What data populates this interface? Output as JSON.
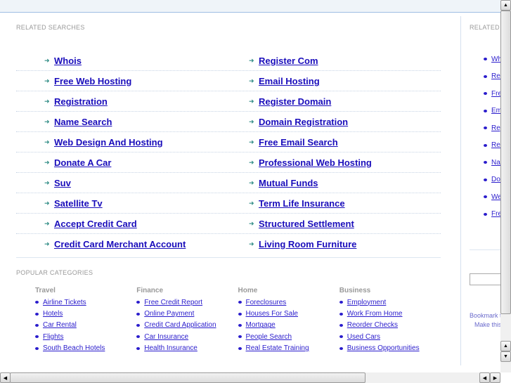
{
  "related": {
    "title": "RELATED SEARCHES",
    "left": [
      "Whois",
      "Free Web Hosting",
      "Registration",
      "Name Search",
      "Web Design And Hosting",
      "Donate A Car",
      "Suv",
      "Satellite Tv",
      "Accept Credit Card",
      "Credit Card Merchant Account"
    ],
    "right": [
      "Register Com",
      "Email Hosting",
      "Register Domain",
      "Domain Registration",
      "Free Email Search",
      "Professional Web Hosting",
      "Mutual Funds",
      "Term Life Insurance",
      "Structured Settlement",
      "Living Room Furniture"
    ]
  },
  "popular": {
    "title": "POPULAR CATEGORIES",
    "categories": [
      {
        "name": "Travel",
        "links": [
          "Airline Tickets",
          "Hotels",
          "Car Rental",
          "Flights",
          "South Beach Hotels"
        ]
      },
      {
        "name": "Finance",
        "links": [
          "Free Credit Report",
          "Online Payment",
          "Credit Card Application",
          "Car Insurance",
          "Health Insurance"
        ]
      },
      {
        "name": "Home",
        "links": [
          "Foreclosures",
          "Houses For Sale",
          "Mortgage",
          "People Search",
          "Real Estate Training"
        ]
      },
      {
        "name": "Business",
        "links": [
          "Employment",
          "Work From Home",
          "Reorder Checks",
          "Used Cars",
          "Business Opportunities"
        ]
      }
    ]
  },
  "sidebar": {
    "title": "RELATED SEARCHES",
    "links": [
      "Whois",
      "Register Com",
      "Free Web Hosting",
      "Email Hosting",
      "Registration",
      "Register Domain",
      "Name Search",
      "Domain Registration",
      "Web Design And Hosting",
      "Free Email Search"
    ],
    "bookmark": "Bookmark this page",
    "make_home": "Make this your homepage"
  },
  "colors": {
    "link": "#1a0dbb",
    "arrow": "#2f8c85"
  },
  "icons": {
    "arrow": "arrow-right-icon",
    "bullet": "bullet-icon"
  }
}
